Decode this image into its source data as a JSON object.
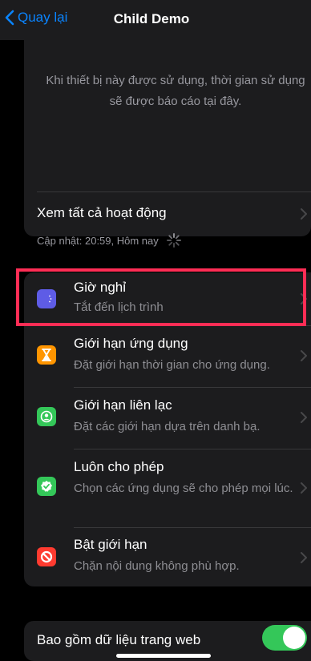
{
  "nav": {
    "back_label": "Quay lại",
    "title": "Child Demo"
  },
  "activity": {
    "empty_message": "Khi thiết bị này được sử dụng, thời gian sử dụng sẽ được báo cáo tại đây.",
    "see_all_label": "Xem tất cả hoạt động",
    "updated_text": "Cập nhật: 20:59, Hôm nay"
  },
  "settings": {
    "items": [
      {
        "title": "Giờ nghỉ",
        "subtitle": "Tắt đến lịch trình",
        "icon": "downtime-icon",
        "color": "#5e5ce6"
      },
      {
        "title": "Giới hạn ứng dụng",
        "subtitle": "Đặt giới hạn thời gian cho ứng dụng.",
        "icon": "hourglass-icon",
        "color": "#ff9500"
      },
      {
        "title": "Giới hạn liên lạc",
        "subtitle": "Đặt các giới hạn dựa trên danh bạ.",
        "icon": "contact-icon",
        "color": "#34c759"
      },
      {
        "title": "Luôn cho phép",
        "subtitle": "Chọn các ứng dụng sẽ cho phép mọi lúc.",
        "icon": "checkmark-badge-icon",
        "color": "#34c759"
      },
      {
        "title": "Bật giới hạn",
        "subtitle": "Chặn nội dung không phù hợp.",
        "icon": "restriction-icon",
        "color": "#ff3b30"
      }
    ]
  },
  "web_data": {
    "label": "Bao gồm dữ liệu trang web",
    "enabled": true
  },
  "colors": {
    "accent": "#0a84ff",
    "highlight": "#ff2d55",
    "toggle_on": "#34c759"
  }
}
